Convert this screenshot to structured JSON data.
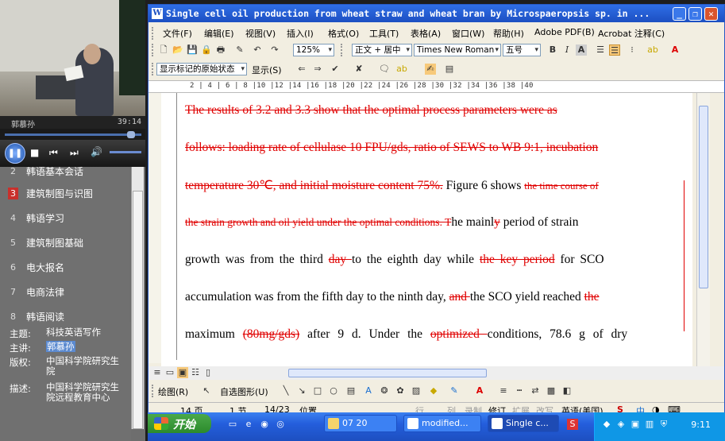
{
  "player": {
    "speaker": "郭慕孙",
    "time": "39:14"
  },
  "course_list": {
    "items": [
      {
        "num": "2",
        "label": "韩语基本会话",
        "active": false
      },
      {
        "num": "3",
        "label": "建筑制图与识图",
        "active": true
      },
      {
        "num": "4",
        "label": "韩语学习",
        "active": false
      },
      {
        "num": "5",
        "label": "建筑制图基础",
        "active": false
      },
      {
        "num": "6",
        "label": "电大报名",
        "active": false
      },
      {
        "num": "7",
        "label": "电商法律",
        "active": false
      },
      {
        "num": "8",
        "label": "韩语阅读",
        "active": false
      }
    ]
  },
  "info": {
    "topic_label": "主题:",
    "topic": "科技英语写作",
    "lecturer_label": "主讲:",
    "lecturer": "郭慕孙",
    "copyright_label": "版权:",
    "copyright": "中国科学院研究生院",
    "desc_label": "描述:",
    "desc": "中国科学院研究生院远程教育中心"
  },
  "word": {
    "title": "Single cell oil production from wheat straw and wheat bran by Microspaeropsis sp. in ...",
    "menus": [
      "文件(F)",
      "编辑(E)",
      "视图(V)",
      "插入(I)",
      "格式(O)",
      "工具(T)",
      "表格(A)",
      "窗口(W)",
      "帮助(H)",
      "Adobe PDF(B)",
      "Acrobat 注释(C)"
    ],
    "zoom": "125%",
    "style": "正文 + 居中",
    "font": "Times New Roman",
    "size": "五号",
    "markup_mode": "显示标记的原始状态",
    "show_label": "显示(S)",
    "ruler": "2  |  4  |  6  |  8  |10  |12  |14  |16  |18  |20  |22  |24  |26  |28  |30  |32  |34  |36  |38  |40",
    "doc": {
      "l1_del": "The results of 3.2 and 3.3 show that the optimal process parameters were as",
      "l2_del": "follows: loading rate of cellulase 10 FPU/gds, ratio of SEWS to WB 9:1, incubation",
      "l3_del": "temperature 30℃, and initial moisture content 75%.",
      "l3_ins": " Figure 6 shows ",
      "l3_del2": "the time course of",
      "l4_del": "the strain growth and oil yield under the optimal conditions. T",
      "l4_ins": "he mainl",
      "l4_del2": "y",
      "l4_ins2": " period of strain",
      "l5_a": "growth was from the third ",
      "l5_del": "day ",
      "l5_b": "to the eighth day while ",
      "l5_del2": "the key period",
      "l5_c": " for SCO",
      "l6_a": "accumulation was from the fifth day to the ninth day, ",
      "l6_del": "and ",
      "l6_b": "the SCO yield reached ",
      "l6_del2": "the",
      "l7_a": "maximum ",
      "l7_del": "(80mg/gds)",
      "l7_b": " after 9 d. Under the ",
      "l7_del2": "optimized ",
      "l7_c": "conditions, 78.6 g of dry"
    },
    "draw_label": "绘图(R)",
    "autoshape_label": "自选图形(U)",
    "status": {
      "page": "14 页",
      "section": "1 节",
      "pages": "14/23",
      "position": "位置",
      "line": "行",
      "col": "列",
      "rec": "录制",
      "trk": "修订",
      "ext": "扩展",
      "ovr": "改写",
      "lang": "英语(美国)"
    }
  },
  "taskbar": {
    "start": "开始",
    "tasks": [
      "07 20",
      "modified...",
      "Single c..."
    ],
    "clock": "9:11"
  }
}
